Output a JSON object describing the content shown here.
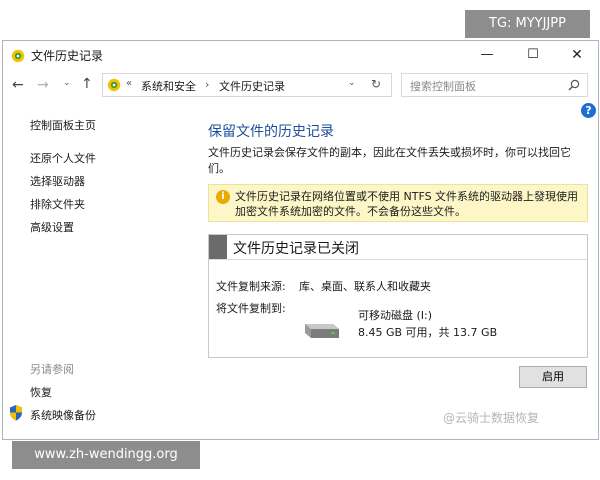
{
  "overlay": {
    "top_tag": "TG: MYYJJPP",
    "bottom_url": "www.zh-wendingg.org",
    "corner_watermark": "@云骑士数据恢复"
  },
  "window": {
    "title": "文件历史记录",
    "buttons": {
      "minimize": "—",
      "maximize": "☐",
      "close": "✕"
    }
  },
  "nav": {
    "back": "←",
    "forward": "→",
    "recent": "⌄",
    "up": "↑",
    "address": {
      "chevrons": "«",
      "crumbs": [
        "系统和安全",
        "文件历史记录"
      ],
      "separator": "›",
      "dropdown": "⌄",
      "refresh": "↻"
    },
    "search_placeholder": "搜索控制面板"
  },
  "help": "?",
  "sidebar": {
    "home": "控制面板主页",
    "items": [
      "还原个人文件",
      "选择驱动器",
      "排除文件夹",
      "高级设置"
    ],
    "see_also": "另请参阅",
    "links": [
      "恢复",
      "系统映像备份"
    ]
  },
  "main": {
    "title": "保留文件的历史记录",
    "description": "文件历史记录会保存文件的副本，因此在文件丢失或损坏时，你可以找回它们。",
    "info_icon": "i",
    "info": "文件历史记录在网络位置或不使用 NTFS 文件系统的驱动器上發現使用加密文件系统加密的文件。不会备份这些文件。",
    "panel": {
      "title": "文件历史记录已关闭",
      "source_label": "文件复制来源:",
      "source_value": "库、桌面、联系人和收藏夹",
      "dest_label": "将文件复制到:",
      "drive_name": "可移动磁盘 (I:)",
      "drive_capacity": "8.45 GB 可用，共 13.7 GB"
    },
    "enable_button": "启用"
  },
  "colors": {
    "accent": "#1e4f9c",
    "info_bg": "#fdf7c8",
    "info_icon": "#e8ac00",
    "help": "#1f6fd1"
  }
}
